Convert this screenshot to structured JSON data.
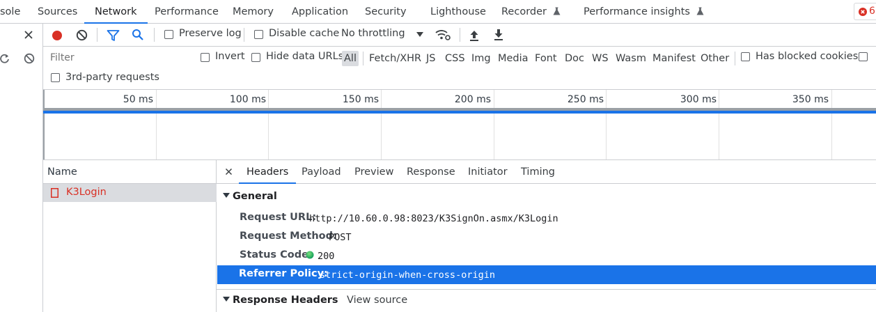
{
  "tabs": [
    {
      "label": "sole"
    },
    {
      "label": "Sources"
    },
    {
      "label": "Network"
    },
    {
      "label": "Performance"
    },
    {
      "label": "Memory"
    },
    {
      "label": "Application"
    },
    {
      "label": "Security"
    },
    {
      "label": "Lighthouse"
    },
    {
      "label": "Recorder"
    },
    {
      "label": "Performance insights"
    }
  ],
  "error_badge": {
    "count": "6"
  },
  "toolbar": {
    "preserve_log": "Preserve log",
    "disable_cache": "Disable cache",
    "throttling": "No throttling"
  },
  "filter": {
    "placeholder": "Filter",
    "invert": "Invert",
    "hide_data_urls": "Hide data URLs",
    "types": [
      "All",
      "Fetch/XHR",
      "JS",
      "CSS",
      "Img",
      "Media",
      "Font",
      "Doc",
      "WS",
      "Wasm",
      "Manifest",
      "Other"
    ],
    "has_blocked_cookies": "Has blocked cookies",
    "third_party": "3rd-party requests"
  },
  "timeline": {
    "ticks": [
      "50 ms",
      "100 ms",
      "150 ms",
      "200 ms",
      "250 ms",
      "300 ms",
      "350 ms"
    ]
  },
  "requests": {
    "column_name": "Name",
    "rows": [
      {
        "name": "K3Login"
      }
    ]
  },
  "details": {
    "tabs": [
      "Headers",
      "Payload",
      "Preview",
      "Response",
      "Initiator",
      "Timing"
    ],
    "general_title": "General",
    "request_url_key": "Request URL:",
    "request_url": "http://10.60.0.98:8023/K3SignOn.asmx/K3Login",
    "request_method_key": "Request Method:",
    "request_method": "POST",
    "status_code_key": "Status Code:",
    "status_code": "200",
    "referrer_policy_key": "Referrer Policy:",
    "referrer_policy": "strict-origin-when-cross-origin",
    "response_headers_title": "Response Headers",
    "view_source": "View source"
  },
  "colors": {
    "accent": "#1a73e8",
    "record": "#d93025",
    "status_ok": "#0f9d58",
    "error_text": "#d93025"
  }
}
